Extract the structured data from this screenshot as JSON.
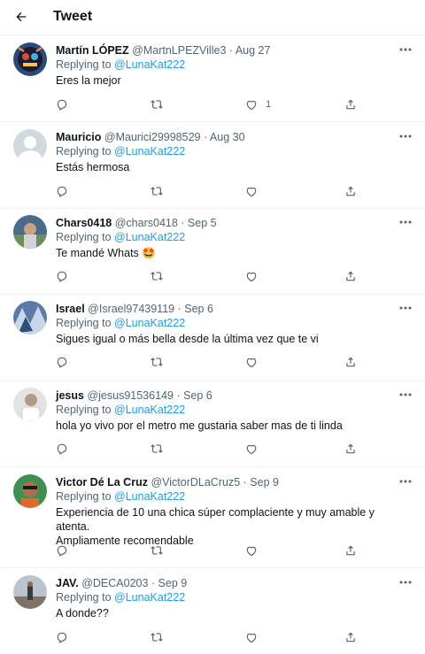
{
  "header": {
    "title": "Tweet",
    "back_icon": "arrow-left-icon"
  },
  "colors": {
    "link": "#1d9bf0",
    "muted": "#536471",
    "text": "#0f1419",
    "divider": "#eff3f4"
  },
  "replying_prefix": "Replying to",
  "reply_to": "@LunaKat222",
  "tweets": [
    {
      "name": "Martín LÓPEZ",
      "handle": "@MartnLPEZVille3",
      "date": "· Aug 27",
      "text": "Eres la mejor",
      "likes": "1",
      "avatar_icon": "cartoon-avatar"
    },
    {
      "name": "Mauricio",
      "handle": "@Maurici29998529",
      "date": "· Aug 30",
      "text": "Estás hermosa",
      "likes": "",
      "avatar_icon": "default-avatar"
    },
    {
      "name": "Chars0418",
      "handle": "@chars0418",
      "date": "· Sep 5",
      "text": "Te mandé Whats 🤩",
      "likes": "",
      "avatar_icon": "photo-avatar"
    },
    {
      "name": "Israel",
      "handle": "@Israel97439119",
      "date": "· Sep 6",
      "text": "Sigues igual o más bella desde la última vez que te vi",
      "likes": "",
      "avatar_icon": "photo-avatar"
    },
    {
      "name": "jesus",
      "handle": "@jesus91536149",
      "date": "· Sep 6",
      "text": "hola yo vivo por el metro me gustaria saber mas de ti linda",
      "likes": "",
      "avatar_icon": "photo-avatar"
    },
    {
      "name": "Victor Dé La Cruz",
      "handle": "@VictorDLaCruz5",
      "date": "· Sep 9",
      "text": "Experiencia de 10 una chica súper complaciente y muy amable y atenta.",
      "text2": "Ampliamente recomendable",
      "likes": "",
      "avatar_icon": "photo-avatar"
    },
    {
      "name": "JAV.",
      "handle": "@DECA0203",
      "date": "· Sep 9",
      "text": "A donde??",
      "likes": "",
      "avatar_icon": "photo-avatar"
    }
  ]
}
